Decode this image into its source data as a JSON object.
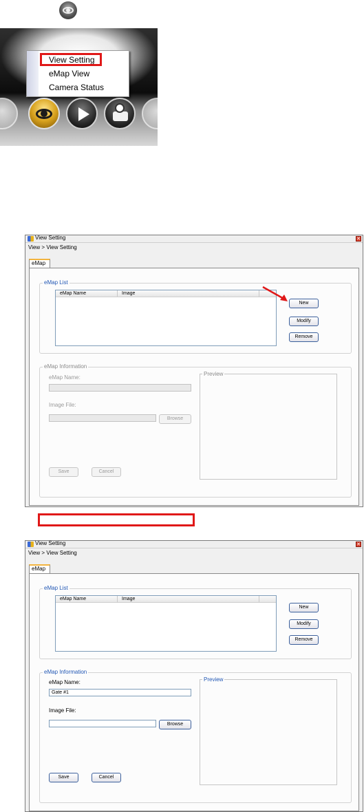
{
  "popup_menu": {
    "items": [
      "View Setting",
      "eMap View",
      "Camera Status"
    ]
  },
  "toolbar": {
    "icons": [
      "view-eye-icon",
      "playback-icon",
      "emap-icon"
    ]
  },
  "window1": {
    "title": "View Setting",
    "close_glyph": "✕",
    "breadcrumb": "View > View Setting",
    "tab_label": "eMap",
    "emap_list": {
      "legend": "eMap List",
      "columns": [
        "eMap Name",
        "Image"
      ],
      "buttons": {
        "new": "New",
        "modify": "Modify",
        "remove": "Remove"
      }
    },
    "emap_info": {
      "legend": "eMap Information",
      "name_label": "eMap Name:",
      "name_value": "",
      "image_label": "Image File:",
      "browse": "Browse",
      "preview_legend": "Preview",
      "save": "Save",
      "cancel": "Cancel"
    }
  },
  "window2": {
    "title": "View Setting",
    "close_glyph": "✕",
    "breadcrumb": "View > View Setting",
    "tab_label": "eMap",
    "emap_list": {
      "legend": "eMap List",
      "columns": [
        "eMap Name",
        "Image"
      ],
      "buttons": {
        "new": "New",
        "modify": "Modify",
        "remove": "Remove"
      }
    },
    "emap_info": {
      "legend": "eMap Information",
      "name_label": "eMap Name:",
      "name_value": "Gate #1",
      "image_label": "Image File:",
      "browse": "Browse",
      "preview_legend": "Preview",
      "save": "Save",
      "cancel": "Cancel"
    }
  },
  "colors": {
    "highlight": "#e01818",
    "legend_active": "#2056b4",
    "tab_accent": "#f2b33d"
  }
}
